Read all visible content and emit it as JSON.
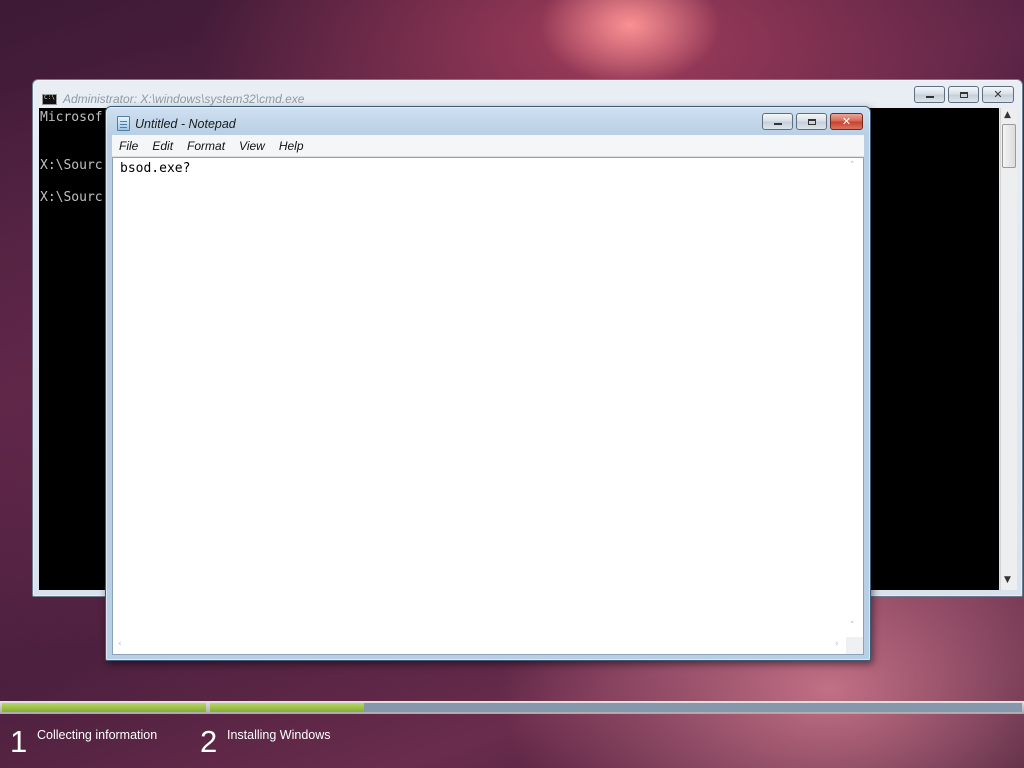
{
  "cmd_window": {
    "title": "Administrator: X:\\windows\\system32\\cmd.exe",
    "console_lines": [
      "Microsof",
      "X:\\Sourc",
      "X:\\Sourc"
    ]
  },
  "notepad": {
    "title": "Untitled - Notepad",
    "menu": [
      "File",
      "Edit",
      "Format",
      "View",
      "Help"
    ],
    "content": "bsod.exe?"
  },
  "setup": {
    "steps": [
      {
        "number": "1",
        "label": "Collecting information",
        "progress": 1.0
      },
      {
        "number": "2",
        "label": "Installing Windows",
        "progress": 0.19
      }
    ],
    "colors": {
      "progress_fill": "#9bc23f",
      "progress_track": "#8797ab"
    }
  },
  "icons": {
    "cmd": "cmd-window-icon",
    "notepad": "notepad-icon",
    "minimize": "minimize-icon",
    "maximize": "maximize-icon",
    "close": "close-icon"
  }
}
